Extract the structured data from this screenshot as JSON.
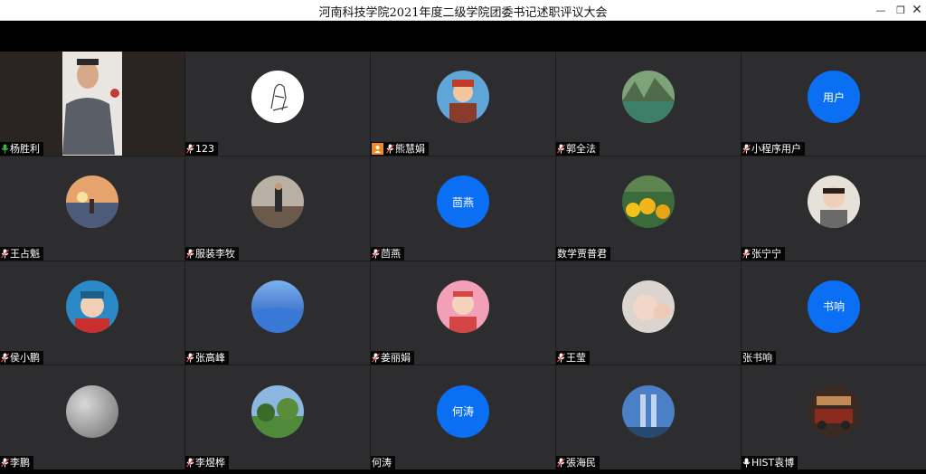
{
  "window": {
    "title": "河南科技学院2021年度二级学院团委书记述职评议大会",
    "min_icon": "minimize-icon",
    "max_icon": "restore-icon",
    "close_icon": "close-icon"
  },
  "colors": {
    "tile_bg": "#2d2d2f",
    "avatar_blue": "#0b6ff4",
    "mic_on": "#3bb54a",
    "mic_off": "#e94343"
  },
  "participants": [
    {
      "name": "杨胜利",
      "avatar": "video",
      "mic": "on"
    },
    {
      "name": "123",
      "avatar": "sketch",
      "mic": "muted"
    },
    {
      "name": "熊慧娟",
      "avatar": "photo-child",
      "mic": "muted",
      "badge": "phone"
    },
    {
      "name": "郭全法",
      "avatar": "photo-lake",
      "mic": "muted"
    },
    {
      "name": "小程序用户",
      "avatar": "text",
      "avatar_text": "用户",
      "mic": "muted"
    },
    {
      "name": "王占魁",
      "avatar": "photo-sunset",
      "mic": "muted"
    },
    {
      "name": "服装李牧",
      "avatar": "photo-outdoor",
      "mic": "muted"
    },
    {
      "name": "茴燕",
      "avatar": "text",
      "avatar_text": "茴燕",
      "mic": "muted"
    },
    {
      "name": "数学贾普君",
      "avatar": "photo-flowers",
      "mic": "none"
    },
    {
      "name": "张宁宁",
      "avatar": "photo-woman",
      "mic": "muted"
    },
    {
      "name": "侯小鹏",
      "avatar": "photo-kid",
      "mic": "muted"
    },
    {
      "name": "张高峰",
      "avatar": "photo-blue",
      "mic": "muted"
    },
    {
      "name": "姜丽娟",
      "avatar": "photo-girl",
      "mic": "muted"
    },
    {
      "name": "王莹",
      "avatar": "photo-toddler",
      "mic": "muted"
    },
    {
      "name": "张书响",
      "avatar": "text",
      "avatar_text": "书响",
      "mic": "none"
    },
    {
      "name": "李鹏",
      "avatar": "photo-gray",
      "mic": "muted"
    },
    {
      "name": "李煜桦",
      "avatar": "photo-park",
      "mic": "muted"
    },
    {
      "name": "何涛",
      "avatar": "text",
      "avatar_text": "何涛",
      "mic": "none"
    },
    {
      "name": "張海民",
      "avatar": "photo-city",
      "mic": "muted"
    },
    {
      "name": "HIST袁博",
      "avatar": "photo-car",
      "mic": "white"
    }
  ]
}
